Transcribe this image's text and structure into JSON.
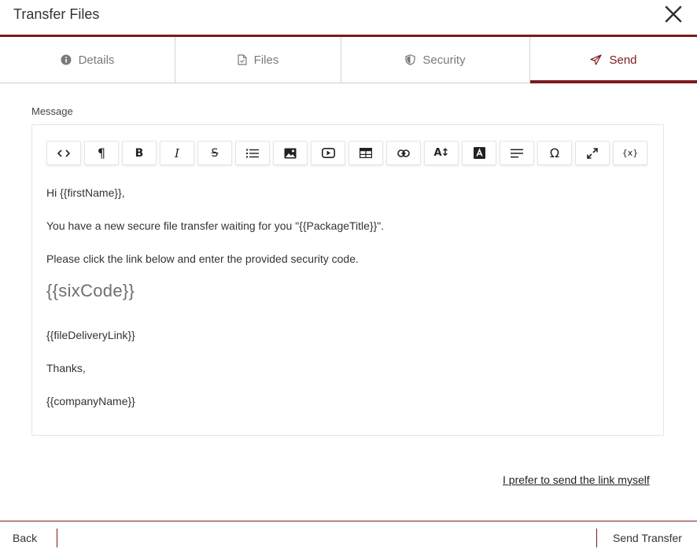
{
  "dialog": {
    "title": "Transfer Files",
    "close_icon": "close-icon"
  },
  "tabs": [
    {
      "label": "Details",
      "icon": "info-circle-icon"
    },
    {
      "label": "Files",
      "icon": "file-check-icon"
    },
    {
      "label": "Security",
      "icon": "shield-icon"
    },
    {
      "label": "Send",
      "icon": "paper-plane-icon",
      "active": true
    }
  ],
  "message": {
    "label": "Message",
    "toolbar": [
      {
        "name": "source-code",
        "icon": "code-icon"
      },
      {
        "name": "paragraph-format",
        "icon": "paragraph-icon"
      },
      {
        "name": "bold",
        "icon": "bold-icon"
      },
      {
        "name": "italic",
        "icon": "italic-icon"
      },
      {
        "name": "strikethrough",
        "icon": "strikethrough-icon"
      },
      {
        "name": "bulleted-list",
        "icon": "list-icon"
      },
      {
        "name": "insert-image",
        "icon": "image-icon"
      },
      {
        "name": "insert-video",
        "icon": "video-icon"
      },
      {
        "name": "insert-table",
        "icon": "table-icon"
      },
      {
        "name": "insert-link",
        "icon": "link-icon"
      },
      {
        "name": "font-size",
        "icon": "font-size-icon"
      },
      {
        "name": "text-color",
        "icon": "text-color-icon"
      },
      {
        "name": "align",
        "icon": "align-left-icon"
      },
      {
        "name": "special-characters",
        "icon": "omega-icon"
      },
      {
        "name": "fullscreen",
        "icon": "expand-icon"
      },
      {
        "name": "insert-variable",
        "icon": "variable-icon"
      }
    ],
    "body": {
      "greeting": "Hi {{firstName}},",
      "line1": "You have a new secure file transfer waiting for you \"{{PackageTitle}}\".",
      "line2": "Please click the link below and enter the provided security code.",
      "code": "{{sixCode}}",
      "link": "{{fileDeliveryLink}}",
      "thanks": "Thanks,",
      "signature": "{{companyName}}"
    }
  },
  "prefer_link": "I prefer to send the link myself",
  "footer": {
    "back": "Back",
    "send": "Send Transfer"
  },
  "colors": {
    "accent": "#7d1a1d",
    "border": "#e4e4e4",
    "text": "#333333"
  }
}
